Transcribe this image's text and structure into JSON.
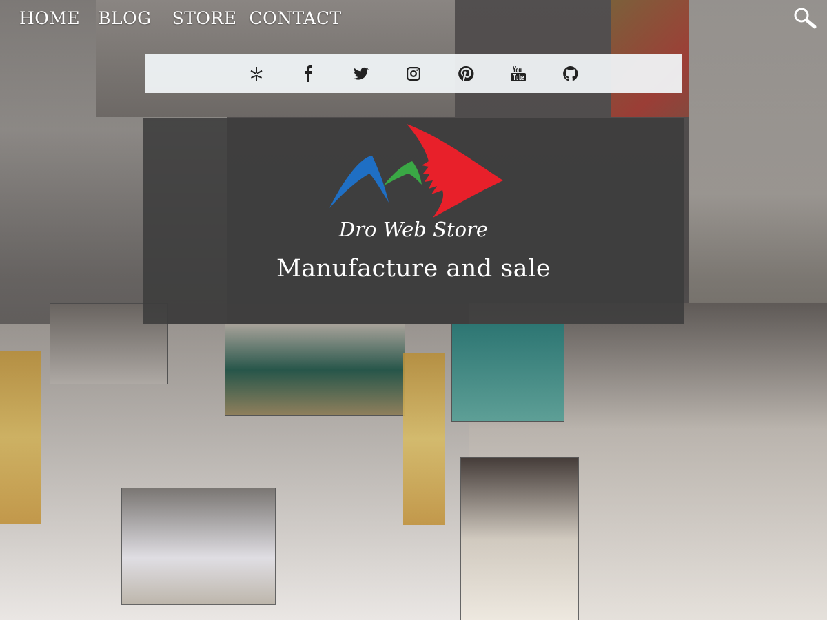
{
  "nav": {
    "items": [
      {
        "label": "HOME"
      },
      {
        "label": "BLOG"
      },
      {
        "label": "STORE"
      },
      {
        "label": "CONTACT"
      }
    ]
  },
  "search": {
    "icon": "search-icon"
  },
  "social": {
    "icons": [
      "yelp-icon",
      "facebook-icon",
      "twitter-icon",
      "instagram-icon",
      "pinterest-icon",
      "youtube-icon",
      "github-icon"
    ]
  },
  "hero": {
    "brand": "Dro Web Store",
    "tagline": "Manufacture and sale"
  },
  "colors": {
    "logo_blue": "#1f6fc4",
    "logo_green": "#3aa845",
    "logo_red": "#e8202a",
    "hero_bg": "#3c3c3c",
    "social_bar_bg": "#f0f4f7"
  }
}
